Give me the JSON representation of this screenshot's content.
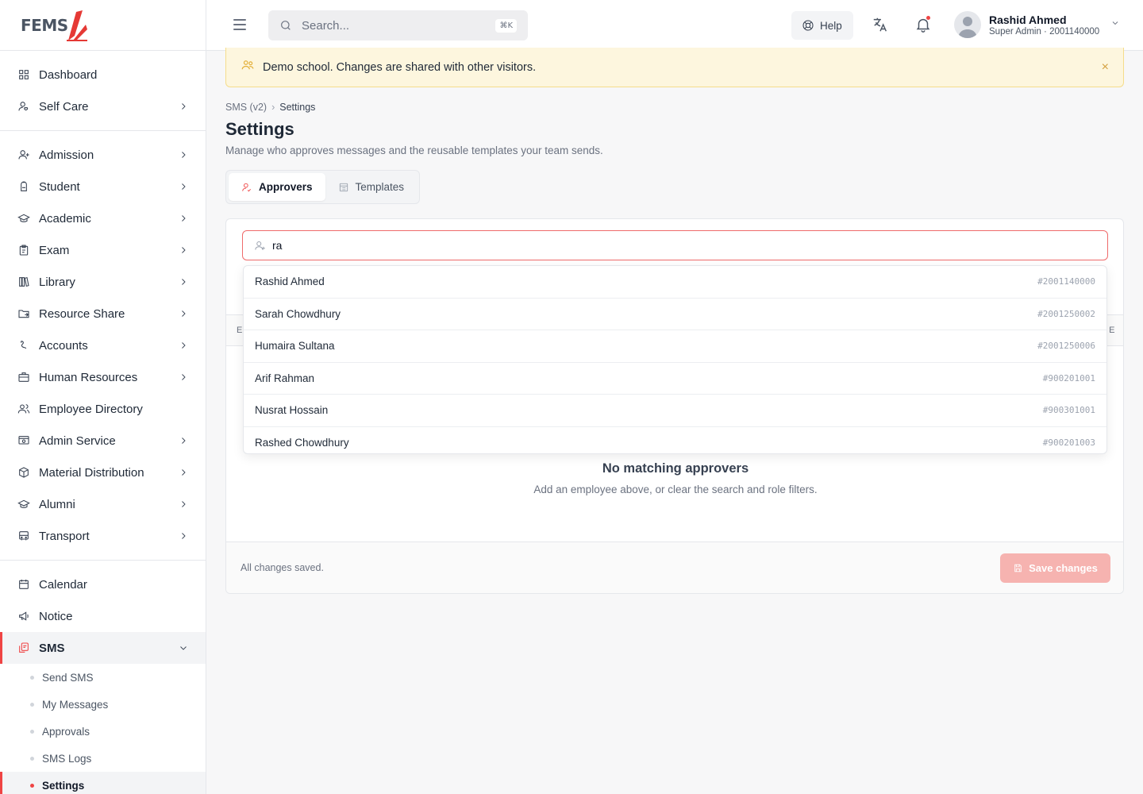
{
  "brand": {
    "logo_text": "FEMS"
  },
  "sidebar": {
    "top": [
      {
        "label": "Dashboard",
        "icon": "grid-icon",
        "chevron": false
      },
      {
        "label": "Self Care",
        "icon": "self-care-icon",
        "chevron": true
      }
    ],
    "modules": [
      {
        "label": "Admission",
        "icon": "user-plus-icon",
        "chevron": true
      },
      {
        "label": "Student",
        "icon": "backpack-icon",
        "chevron": true
      },
      {
        "label": "Academic",
        "icon": "graduation-cap-icon",
        "chevron": true
      },
      {
        "label": "Exam",
        "icon": "clipboard-icon",
        "chevron": true
      },
      {
        "label": "Library",
        "icon": "books-icon",
        "chevron": true
      },
      {
        "label": "Resource Share",
        "icon": "folder-share-icon",
        "chevron": true
      },
      {
        "label": "Accounts",
        "icon": "money-icon",
        "chevron": true
      },
      {
        "label": "Human Resources",
        "icon": "briefcase-icon",
        "chevron": true
      },
      {
        "label": "Employee Directory",
        "icon": "users-icon",
        "chevron": false
      },
      {
        "label": "Admin Service",
        "icon": "admin-icon",
        "chevron": true
      },
      {
        "label": "Material Distribution",
        "icon": "box-icon",
        "chevron": true
      },
      {
        "label": "Alumni",
        "icon": "graduation-cap-icon",
        "chevron": true
      },
      {
        "label": "Transport",
        "icon": "bus-icon",
        "chevron": true
      }
    ],
    "comms": [
      {
        "label": "Calendar",
        "icon": "calendar-icon"
      },
      {
        "label": "Notice",
        "icon": "megaphone-icon"
      },
      {
        "label": "SMS",
        "icon": "sms-icon",
        "expanded": true
      }
    ],
    "sms_sub": [
      {
        "label": "Send SMS",
        "active": false
      },
      {
        "label": "My Messages",
        "active": false
      },
      {
        "label": "Approvals",
        "active": false
      },
      {
        "label": "SMS Logs",
        "active": false
      },
      {
        "label": "Settings",
        "active": true
      }
    ]
  },
  "topbar": {
    "search_placeholder": "Search...",
    "search_shortcut": "⌘K",
    "help_label": "Help",
    "user_name": "Rashid Ahmed",
    "user_role": "Super Admin · 2001140000"
  },
  "banner": {
    "text": "Demo school. Changes are shared with other visitors.",
    "close": "×"
  },
  "breadcrumb": {
    "parent": "SMS (v2)",
    "sep": "›",
    "current": "Settings"
  },
  "page": {
    "title": "Settings",
    "subtitle": "Manage who approves messages and the reusable templates your team sends."
  },
  "tabs": [
    {
      "label": "Approvers",
      "active": true
    },
    {
      "label": "Templates",
      "active": false
    }
  ],
  "approvers": {
    "search_value": "ra",
    "table_header_left": "E",
    "table_header_right": "E",
    "results": [
      {
        "name": "Rashid Ahmed",
        "id": "#2001140000"
      },
      {
        "name": "Sarah Chowdhury",
        "id": "#2001250002"
      },
      {
        "name": "Humaira Sultana",
        "id": "#2001250006"
      },
      {
        "name": "Arif Rahman",
        "id": "#900201001"
      },
      {
        "name": "Nusrat Hossain",
        "id": "#900301001"
      },
      {
        "name": "Rashed Chowdhury",
        "id": "#900201003"
      }
    ],
    "empty_title": "No matching approvers",
    "empty_sub": "Add an employee above, or clear the search and role filters.",
    "status": "All changes saved.",
    "save_label": "Save changes"
  },
  "colors": {
    "accent": "#ef4444",
    "banner_bg": "#fdf6de",
    "save_disabled": "#f6b3b0"
  }
}
